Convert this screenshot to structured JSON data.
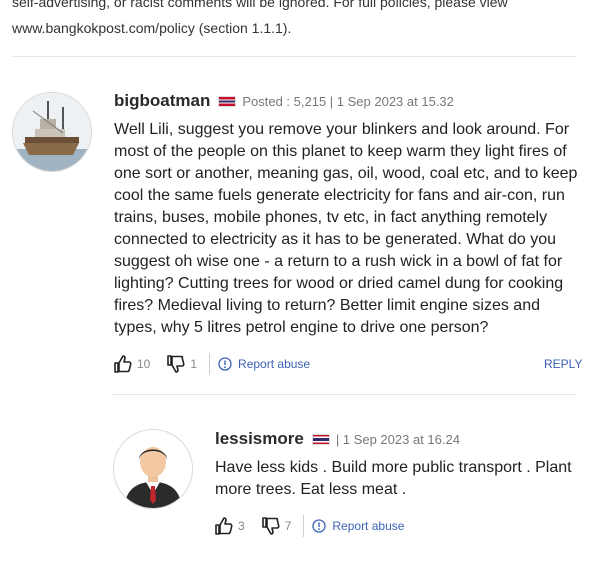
{
  "policy": {
    "line1": "self-advertising, or racist comments will be ignored. For full policies, please view",
    "line2": "www.bangkokpost.com/policy (section 1.1.1)."
  },
  "comments": [
    {
      "username": "bigboatman",
      "meta": "Posted : 5,215 | 1 Sep 2023 at 15.32",
      "text": "Well Lili, suggest you remove your blinkers and look around. For most of the people on this planet to keep warm they light fires of one sort or another, meaning gas, oil, wood, coal etc, and to keep cool the same fuels generate electricity for fans and air-con, run trains, buses, mobile phones, tv etc, in fact anything remotely connected to electricity as it has to be generated. What do you suggest oh wise one - a return to a rush wick in a bowl of fat for lighting? Cutting trees for wood or dried camel dung for cooking fires? Medieval living to return? Better limit engine sizes and types, why 5 litres petrol engine to drive one person?",
      "likes": "10",
      "dislikes": "1",
      "report_label": "Report abuse",
      "reply_label": "REPLY",
      "avatar": "boat-avatar"
    },
    {
      "username": "lessismore",
      "meta": "| 1 Sep 2023 at 16.24",
      "text": "Have less kids . Build more public transport . Plant more trees. Eat less meat .",
      "likes": "3",
      "dislikes": "7",
      "report_label": "Report abuse",
      "avatar": "person-avatar"
    }
  ],
  "colors": {
    "link": "#3b62b5",
    "muted": "#888888"
  }
}
